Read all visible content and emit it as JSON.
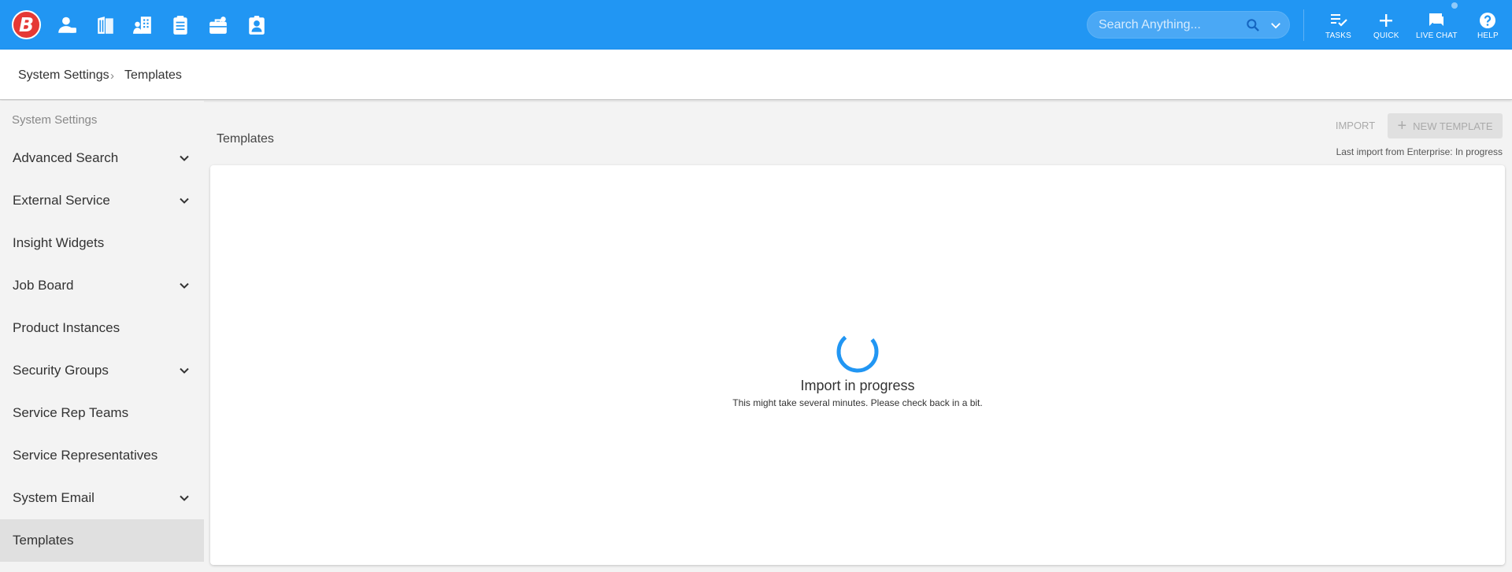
{
  "topbar": {
    "logo_letter": "B",
    "nav_icons": [
      "person-icon",
      "building-icon",
      "company-icon",
      "clipboard-icon",
      "briefcase-icon",
      "contact-card-icon"
    ],
    "search": {
      "placeholder": "Search Anything..."
    },
    "actions": [
      {
        "label": "TASKS",
        "icon": "tasks-icon"
      },
      {
        "label": "QUICK",
        "icon": "plus-icon"
      },
      {
        "label": "LIVE CHAT",
        "icon": "chat-icon"
      },
      {
        "label": "HELP",
        "icon": "help-icon"
      }
    ],
    "colors": {
      "bar": "#2196f3",
      "logo": "#e53935"
    }
  },
  "breadcrumb": {
    "root": "System Settings",
    "current": "Templates"
  },
  "sidebar": {
    "heading": "System Settings",
    "items": [
      {
        "label": "Advanced Search",
        "expandable": true
      },
      {
        "label": "External Service",
        "expandable": true
      },
      {
        "label": "Insight Widgets",
        "expandable": false
      },
      {
        "label": "Job Board",
        "expandable": true
      },
      {
        "label": "Product Instances",
        "expandable": false
      },
      {
        "label": "Security Groups",
        "expandable": true
      },
      {
        "label": "Service Rep Teams",
        "expandable": false
      },
      {
        "label": "Service Representatives",
        "expandable": false
      },
      {
        "label": "System Email",
        "expandable": true
      },
      {
        "label": "Templates",
        "expandable": false,
        "active": true
      }
    ]
  },
  "main": {
    "title": "Templates",
    "import_label": "IMPORT",
    "new_template_label": "NEW TEMPLATE",
    "last_import": "Last import from Enterprise: In progress",
    "progress_title": "Import in progress",
    "progress_message": "This might take several minutes. Please check back in a bit."
  }
}
